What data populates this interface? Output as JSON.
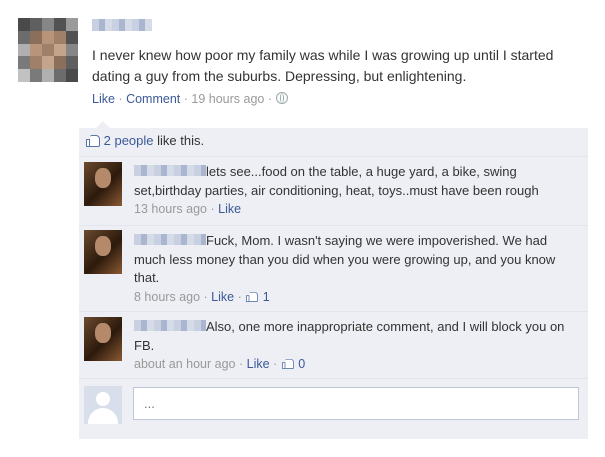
{
  "post": {
    "author": "",
    "text": "I never knew how poor my family was while I was growing up until I started dating a guy from the suburbs. Depressing, but enlightening.",
    "like_label": "Like",
    "comment_label": "Comment",
    "timestamp": "19 hours ago",
    "separator": "·",
    "privacy_icon": "globe-icon"
  },
  "likes": {
    "icon": "thumb-icon",
    "count_label": "2 people",
    "suffix": " like this."
  },
  "comments": [
    {
      "author": "",
      "text": "lets see...food on the table, a huge yard, a bike, swing set,birthday parties, air conditioning, heat, toys..must have been rough",
      "timestamp": "13 hours ago",
      "like_label": "Like",
      "like_count": ""
    },
    {
      "author": "",
      "text": "Fuck, Mom. I wasn't saying we were impoverished. We had much less money than you did when you were growing up, and you know that.",
      "timestamp": "8 hours ago",
      "like_label": "Like",
      "like_count": "1"
    },
    {
      "author": "",
      "text": "Also, one more inappropriate comment, and I will block you on FB.",
      "timestamp": "about an hour ago",
      "like_label": "Like",
      "like_count": "0"
    }
  ],
  "composer": {
    "placeholder": "..."
  }
}
